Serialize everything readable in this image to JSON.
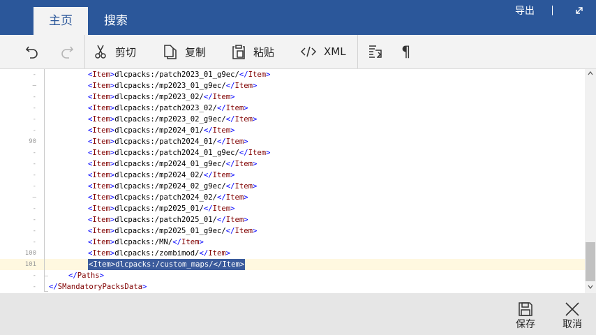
{
  "tabs": [
    {
      "label": "主页",
      "active": true
    },
    {
      "label": "搜索",
      "active": false
    }
  ],
  "topbar": {
    "export_label": "导出",
    "divider": "|"
  },
  "ribbon": {
    "undo_icon": "undo-icon",
    "redo_icon": "redo-icon",
    "cut_label": "剪切",
    "copy_label": "复制",
    "paste_label": "粘贴",
    "xml_label": "XML",
    "format_icon": "format-document-icon",
    "pilcrow": "¶"
  },
  "editor": {
    "line_numbers": [
      "-",
      "–",
      "-",
      "-",
      "-",
      "-",
      "90",
      "-",
      "-",
      "-",
      "-",
      "–",
      "-",
      "-",
      "-",
      "-",
      "100",
      "101",
      "-",
      "-"
    ],
    "items": [
      "dlcpacks:/patch2023_01_g9ec/",
      "dlcpacks:/mp2023_01_g9ec/",
      "dlcpacks:/mp2023_02/",
      "dlcpacks:/patch2023_02/",
      "dlcpacks:/mp2023_02_g9ec/",
      "dlcpacks:/mp2024_01/",
      "dlcpacks:/patch2024_01/",
      "dlcpacks:/patch2024_01_g9ec/",
      "dlcpacks:/mp2024_01_g9ec/",
      "dlcpacks:/mp2024_02/",
      "dlcpacks:/mp2024_02_g9ec/",
      "dlcpacks:/patch2024_02/",
      "dlcpacks:/mp2025_01/",
      "dlcpacks:/patch2025_01/",
      "dlcpacks:/mp2025_01_g9ec/",
      "dlcpacks:/MN/",
      "dlcpacks:/zombimod/",
      "dlcpacks:/custom_maps/"
    ],
    "item_tag": "Item",
    "selected_index": 17,
    "paths_close": "</Paths>",
    "root_close": "</SMandatoryPacksData>"
  },
  "bottombar": {
    "save_label": "保存",
    "cancel_label": "取消"
  },
  "colors": {
    "titlebar": "#2b579a",
    "ribbon": "#f3f3f3",
    "tag_bracket": "#0000ff",
    "tag_name": "#800000",
    "selection": "#3b5b9c",
    "current_line": "#fff8e0",
    "bottombar": "#e6e6e6"
  }
}
